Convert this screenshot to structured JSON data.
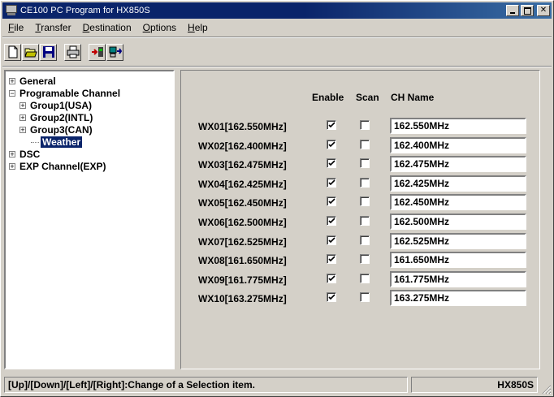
{
  "window": {
    "title": "CE100  PC Program for HX850S"
  },
  "menu": [
    {
      "label": "File",
      "ul": "F",
      "rest": "ile"
    },
    {
      "label": "Transfer",
      "ul": "T",
      "rest": "ransfer"
    },
    {
      "label": "Destination",
      "ul": "D",
      "rest": "estination"
    },
    {
      "label": "Options",
      "ul": "O",
      "rest": "ptions"
    },
    {
      "label": "Help",
      "ul": "H",
      "rest": "elp"
    }
  ],
  "tree": {
    "general": "General",
    "programable": "Programable Channel",
    "group1": "Group1(USA)",
    "group2": "Group2(INTL)",
    "group3": "Group3(CAN)",
    "weather": "Weather",
    "dsc": "DSC",
    "exp": "EXP Channel(EXP)"
  },
  "headers": {
    "enable": "Enable",
    "scan": "Scan",
    "ch_name": "CH Name"
  },
  "rows": [
    {
      "label": "WX01[162.550MHz]",
      "enable": true,
      "scan": false,
      "name": "162.550MHz"
    },
    {
      "label": "WX02[162.400MHz]",
      "enable": true,
      "scan": false,
      "name": "162.400MHz"
    },
    {
      "label": "WX03[162.475MHz]",
      "enable": true,
      "scan": false,
      "name": "162.475MHz"
    },
    {
      "label": "WX04[162.425MHz]",
      "enable": true,
      "scan": false,
      "name": "162.425MHz"
    },
    {
      "label": "WX05[162.450MHz]",
      "enable": true,
      "scan": false,
      "name": "162.450MHz"
    },
    {
      "label": "WX06[162.500MHz]",
      "enable": true,
      "scan": false,
      "name": "162.500MHz"
    },
    {
      "label": "WX07[162.525MHz]",
      "enable": true,
      "scan": false,
      "name": "162.525MHz"
    },
    {
      "label": "WX08[161.650MHz]",
      "enable": true,
      "scan": false,
      "name": "161.650MHz"
    },
    {
      "label": "WX09[161.775MHz]",
      "enable": true,
      "scan": false,
      "name": "161.775MHz"
    },
    {
      "label": "WX10[163.275MHz]",
      "enable": true,
      "scan": false,
      "name": "163.275MHz"
    }
  ],
  "status": {
    "hint": "[Up]/[Down]/[Left]/[Right]:Change of a Selection item.",
    "model": "HX850S"
  }
}
